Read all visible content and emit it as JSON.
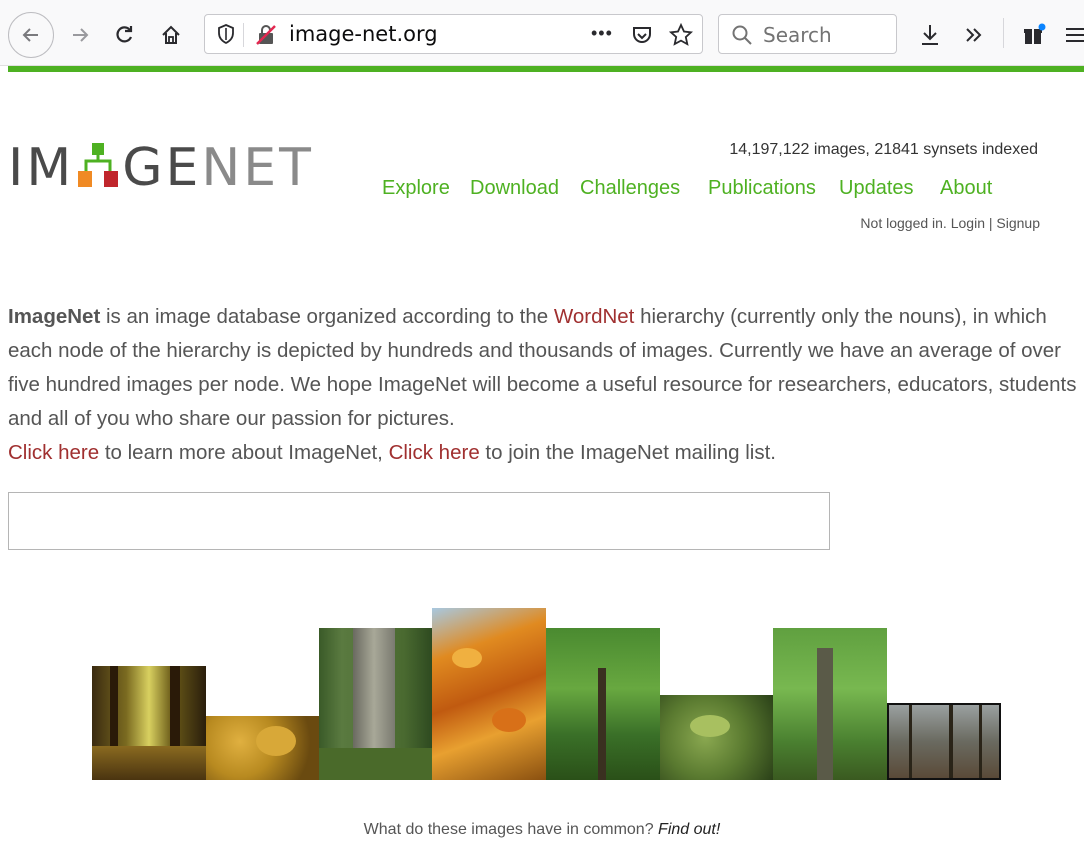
{
  "browser": {
    "url": "image-net.org",
    "search_placeholder": "Search",
    "page_actions_glyph": "•••"
  },
  "header": {
    "logo": {
      "part1": "IM",
      "part2": "GE",
      "part3": "NET"
    },
    "stats": "14,197,122 images, 21841 synsets indexed",
    "nav": [
      "Explore",
      "Download",
      "Challenges",
      "Publications",
      "Updates",
      "About"
    ],
    "login": {
      "prefix": "Not logged in. ",
      "login": "Login",
      "separator": " | ",
      "signup": "Signup"
    }
  },
  "intro": {
    "brand": "ImageNet",
    "text1": " is an image database organized according to the ",
    "wordnet": "WordNet",
    "text2": " hierarchy (currently only the nouns), in which each node of the hierarchy is depicted by hundreds and thousands of images. Currently we have an average of over five hundred images per node. We hope ImageNet will become a useful resource for researchers, educators, students and all of you who share our passion for pictures.",
    "click1": "Click here",
    "text3": " to learn more about ImageNet, ",
    "click2": "Click here",
    "text4": " to join the ImageNet mailing list."
  },
  "search": {
    "value": ""
  },
  "gallery": {
    "photos": [
      "forest-sunlight",
      "autumn-leaves",
      "carved-tree-trunk",
      "orange-leaves",
      "green-canopy",
      "leaves-closeup",
      "tall-tree",
      "winter-woods"
    ]
  },
  "footer": {
    "question": "What do these images have in common? ",
    "link": "Find out!"
  },
  "colors": {
    "accent_green": "#4eb122",
    "link_red": "#a03030",
    "text_gray": "#555555"
  }
}
